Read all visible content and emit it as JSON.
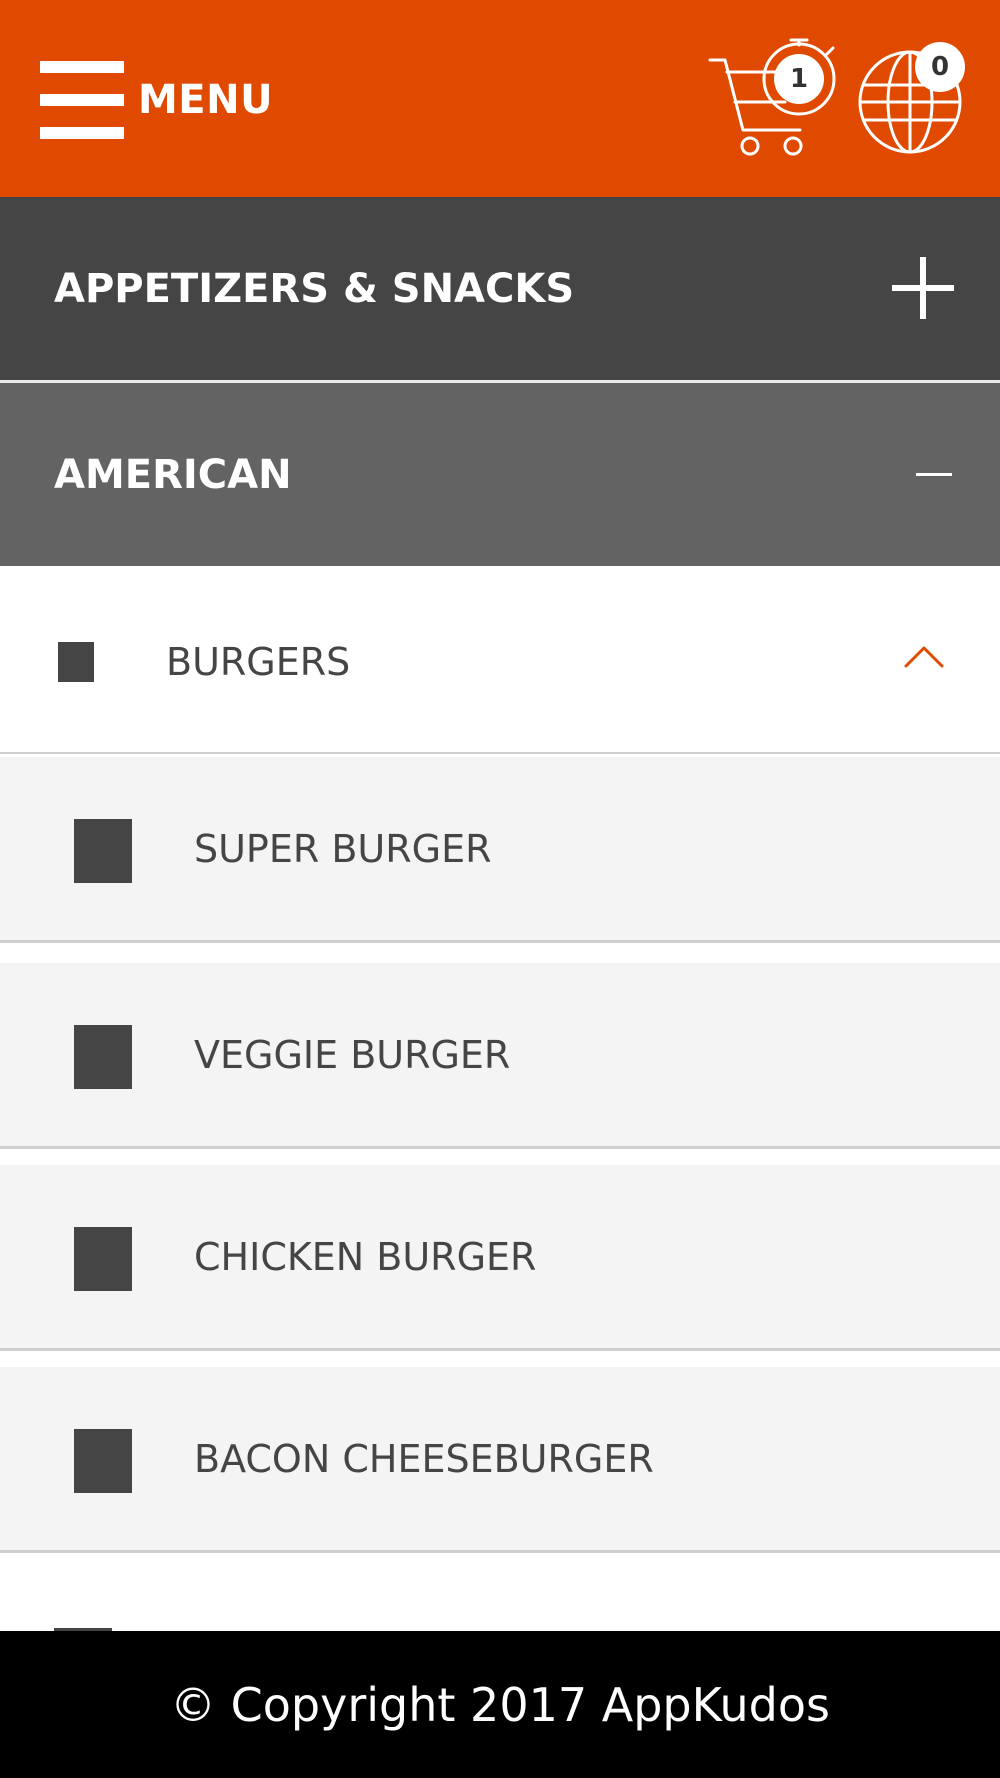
{
  "header": {
    "menu_label": "MENU",
    "cart_count": "1",
    "globe_count": "0",
    "background_color": "#e04a00",
    "icons": [
      "hamburger-icon",
      "cart-timer-icon",
      "globe-icon"
    ]
  },
  "categories": [
    {
      "label": "APPETIZERS & SNACKS",
      "state": "collapsed",
      "icon": "plus-icon"
    },
    {
      "label": "AMERICAN",
      "state": "expanded",
      "icon": "minus-icon"
    }
  ],
  "subcategory": {
    "label": "BURGERS",
    "state": "expanded",
    "icon": "chevron-up-icon"
  },
  "items": [
    {
      "label": "SUPER BURGER"
    },
    {
      "label": "VEGGIE BURGER"
    },
    {
      "label": "CHICKEN BURGER"
    },
    {
      "label": "BACON CHEESEBURGER"
    }
  ],
  "footer": {
    "text": "© Copyright 2017 AppKudos"
  },
  "colors": {
    "accent": "#e04a00",
    "category_dark": "#454545",
    "category_active": "#636363",
    "item_background": "#f4f4f4"
  }
}
